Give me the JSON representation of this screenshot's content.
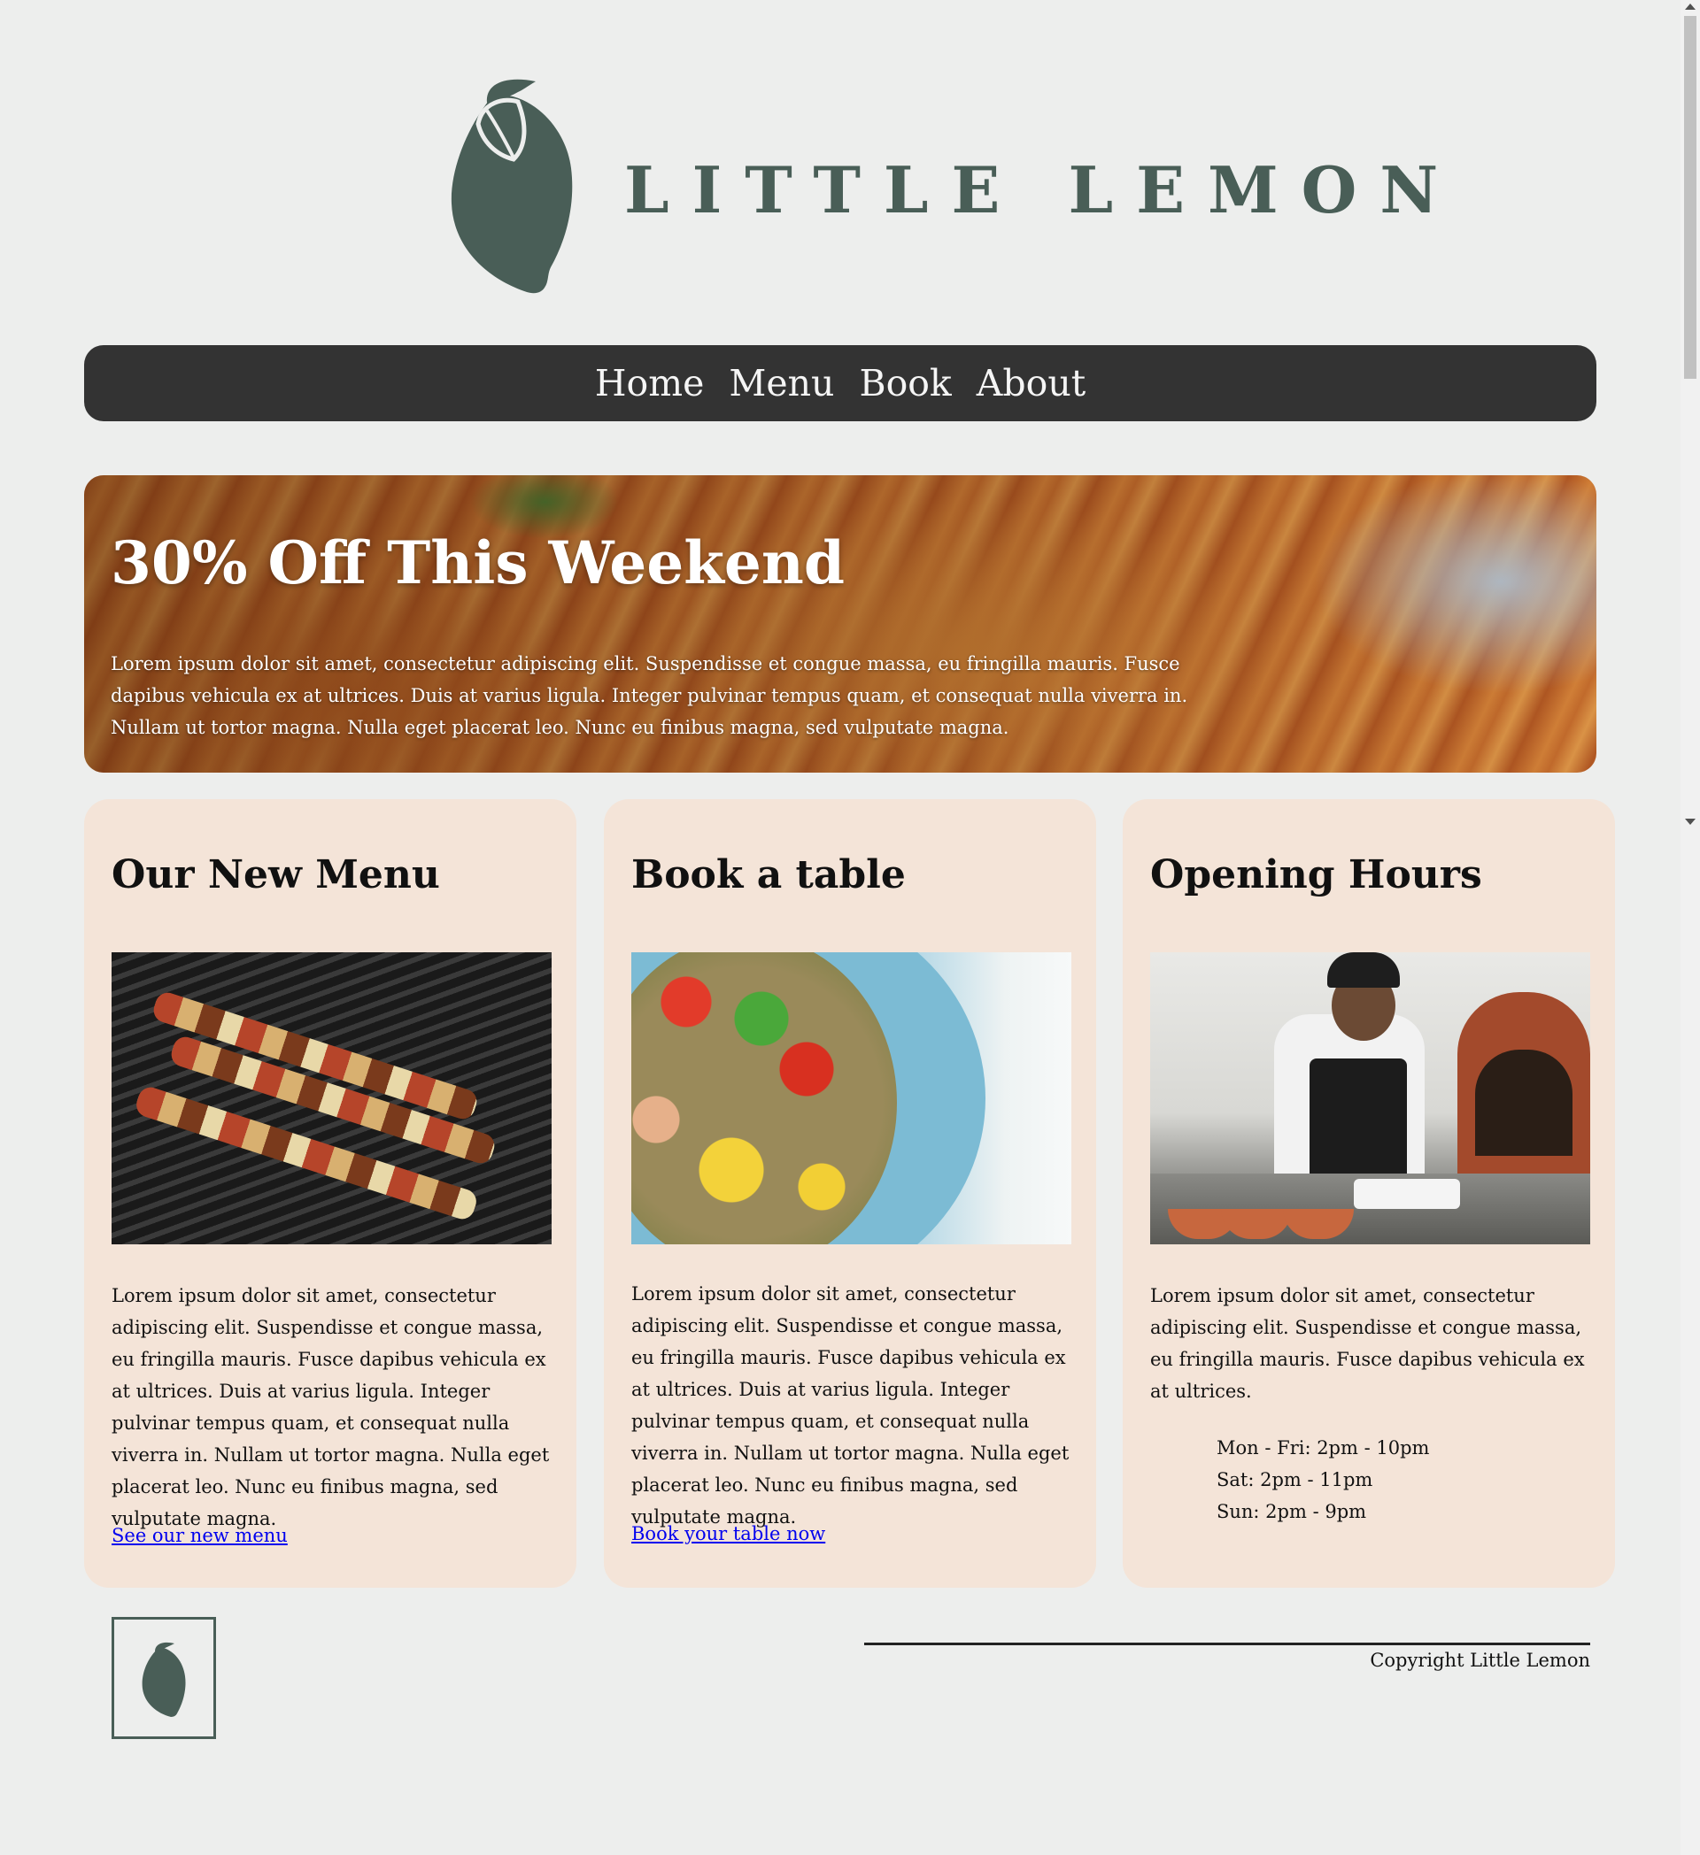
{
  "brand": {
    "name": "LITTLE LEMON",
    "color": "#495e57"
  },
  "nav": {
    "items": [
      "Home",
      "Menu",
      "Book",
      "About"
    ],
    "background": "#333333"
  },
  "hero": {
    "title": "30% Off This Weekend",
    "text": "Lorem ipsum dolor sit amet, consectetur adipiscing elit. Suspendisse et congue massa, eu fringilla mauris. Fusce dapibus vehicula ex at ultrices. Duis at varius ligula. Integer pulvinar tempus quam, et consequat nulla viverra in. Nullam ut tortor magna. Nulla eget placerat leo. Nunc eu finibus magna, sed vulputate magna."
  },
  "cards": [
    {
      "title": "Our New Menu",
      "image": "grilled-skewers-photo",
      "text": "Lorem ipsum dolor sit amet, consectetur adipiscing elit. Suspendisse et congue massa, eu fringilla mauris. Fusce dapibus vehicula ex at ultrices. Duis at varius ligula. Integer pulvinar tempus quam, et consequat nulla viverra in. Nullam ut tortor magna. Nulla eget placerat leo. Nunc eu finibus magna, sed vulputate magna.",
      "link": "See our new menu"
    },
    {
      "title": "Book a table",
      "image": "salad-plate-photo",
      "text": "Lorem ipsum dolor sit amet, consectetur adipiscing elit. Suspendisse et congue massa, eu fringilla mauris. Fusce dapibus vehicula ex at ultrices. Duis at varius ligula. Integer pulvinar tempus quam, et consequat nulla viverra in. Nullam ut tortor magna. Nulla eget placerat leo. Nunc eu finibus magna, sed vulputate magna.",
      "link": "Book your table now"
    },
    {
      "title": "Opening Hours",
      "image": "chef-kitchen-photo",
      "text": "Lorem ipsum dolor sit amet, consectetur adipiscing elit. Suspendisse et congue massa, eu fringilla mauris. Fusce dapibus vehicula ex at ultrices.",
      "hours": [
        "Mon - Fri: 2pm - 10pm",
        "Sat: 2pm - 11pm",
        "Sun: 2pm - 9pm"
      ]
    }
  ],
  "card_background": "#f4e4d8",
  "footer": {
    "copyright": "Copyright Little Lemon"
  }
}
